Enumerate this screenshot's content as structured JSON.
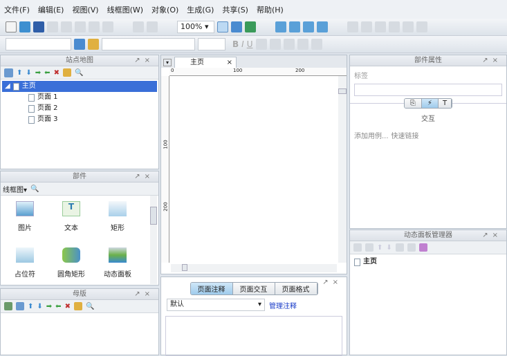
{
  "menu": [
    "文件(F)",
    "编辑(E)",
    "视图(V)",
    "线框图(W)",
    "对象(O)",
    "生成(G)",
    "共享(S)",
    "帮助(H)"
  ],
  "toolbar": {
    "zoom": "100%"
  },
  "sitemap": {
    "title": "站点地图",
    "root": "主页",
    "pages": [
      "页面 1",
      "页面 2",
      "页面 3"
    ]
  },
  "widgets": {
    "title": "部件",
    "library": "线框图",
    "items": [
      "图片",
      "文本",
      "矩形",
      "占位符",
      "圆角矩形",
      "动态面板"
    ]
  },
  "masters": {
    "title": "母版"
  },
  "canvas": {
    "tab": "主页",
    "ruler_top": [
      "0",
      "100",
      "200"
    ],
    "ruler_left": [
      "100",
      "200"
    ]
  },
  "notes": {
    "tabs": [
      "页面注释",
      "页面交互",
      "页面格式"
    ],
    "select": "默认",
    "manage_link": "管理注释"
  },
  "properties": {
    "title": "部件属性",
    "label": "标签",
    "section": "交互",
    "add_case": "添加用例...",
    "quick_link": "快速链接"
  },
  "dynamic_panel": {
    "title": "动态面板管理器",
    "item": "主页"
  },
  "colors": {
    "accent": "#3a6fd8",
    "link": "#1a3cc8"
  }
}
